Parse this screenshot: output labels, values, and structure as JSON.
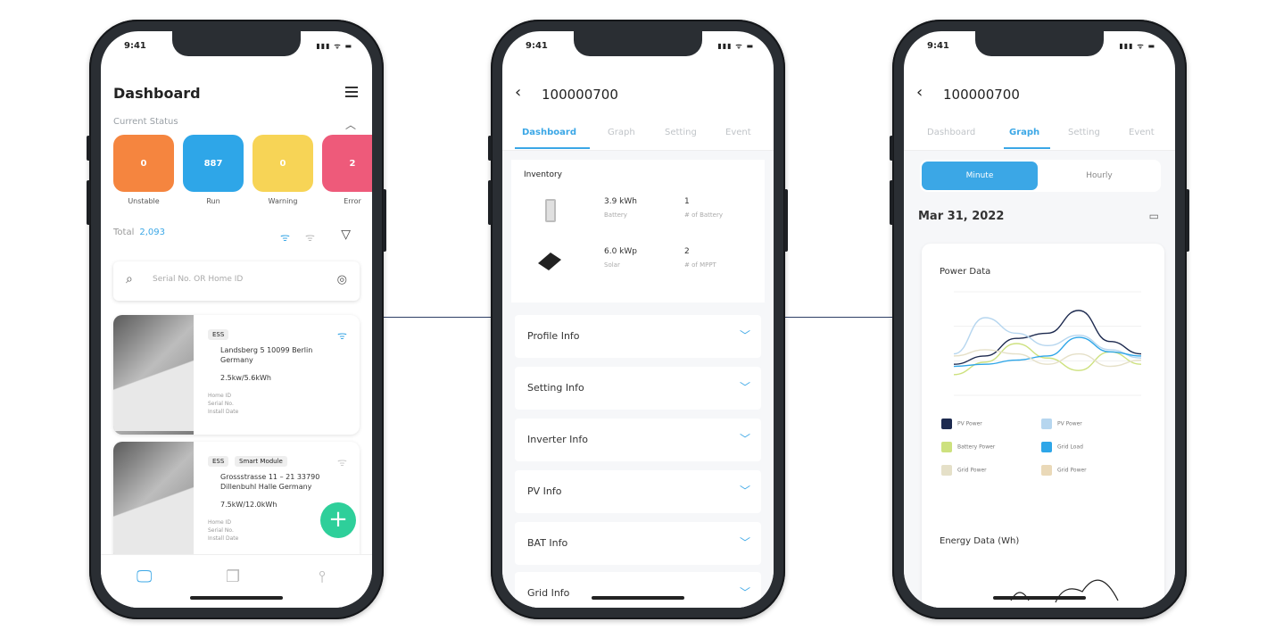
{
  "status_bar": {
    "time": "9:41",
    "signal": "▮▮▮ ᯤ ▬"
  },
  "dashboard": {
    "title": "Dashboard",
    "section_label": "Current Status",
    "cards": [
      {
        "count": "0",
        "label": "Unstable",
        "color": "#f5853f"
      },
      {
        "count": "887",
        "label": "Run",
        "color": "#2ea6e8"
      },
      {
        "count": "0",
        "label": "Warning",
        "color": "#f7d456"
      },
      {
        "count": "2",
        "label": "Error",
        "color": "#ee5a7a"
      }
    ],
    "total_label": "Total",
    "total_value": "2,093",
    "search_placeholder": "Serial No. OR Home ID",
    "plants": [
      {
        "tag": "ESS",
        "address": "Landsberg 5 10099 Berlin Germany",
        "capacity": "2.5kw/5.6kWh",
        "meta": "Home ID\nSerial No.\nInstall Date"
      },
      {
        "tag": "ESS",
        "tag2": "Smart Module",
        "address": "Grossstrasse 11 – 21 33790 Dillenbuhl Halle Germany",
        "capacity": "7.5kW/12.0kWh",
        "meta": "Home ID\nSerial No.\nInstall Date"
      }
    ]
  },
  "device": {
    "id": "100000700",
    "tabs": [
      "Dashboard",
      "Graph",
      "Setting",
      "Event"
    ],
    "inventory_title": "Inventory",
    "inventory": [
      {
        "value": "3.9 kWh",
        "label": "Battery",
        "count": "1",
        "count_label": "# of Battery"
      },
      {
        "value": "6.0 kWp",
        "label": "Solar",
        "count": "2",
        "count_label": "# of MPPT"
      }
    ],
    "sections": [
      "Profile Info",
      "Setting Info",
      "Inverter Info",
      "PV Info",
      "BAT Info",
      "Grid Info"
    ]
  },
  "graph": {
    "toggle": [
      "Minute",
      "Hourly"
    ],
    "date": "Mar 31, 2022",
    "power_title": "Power Data",
    "legend": [
      {
        "name": "PV Power",
        "color": "#1d2a4f",
        "checked": true
      },
      {
        "name": "PV Power",
        "color": "#b6d6ef",
        "checked": false
      },
      {
        "name": "Battery Power",
        "color": "#cde17e",
        "checked": true
      },
      {
        "name": "Grid Load",
        "color": "#2ea6e8",
        "checked": true
      },
      {
        "name": "Grid Power",
        "color": "#e5e0c8",
        "checked": false
      },
      {
        "name": "Grid Power",
        "color": "#ead9b8",
        "checked": false
      }
    ],
    "energy_title": "Energy Data (Wh)",
    "chart_data": {
      "type": "line",
      "x": [
        1,
        2,
        3,
        4,
        5,
        6,
        7
      ],
      "series": [
        {
          "name": "PV Power",
          "values": [
            30,
            38,
            55,
            60,
            82,
            52,
            40
          ]
        },
        {
          "name": "PV Power",
          "values": [
            40,
            75,
            60,
            48,
            58,
            44,
            36
          ]
        },
        {
          "name": "Battery Power",
          "values": [
            20,
            32,
            50,
            36,
            24,
            42,
            30
          ]
        },
        {
          "name": "Grid Load",
          "values": [
            28,
            30,
            34,
            38,
            56,
            42,
            38
          ]
        },
        {
          "name": "Grid Power",
          "values": [
            38,
            44,
            40,
            30,
            40,
            28,
            34
          ]
        }
      ],
      "ylim": [
        0,
        100
      ]
    }
  }
}
